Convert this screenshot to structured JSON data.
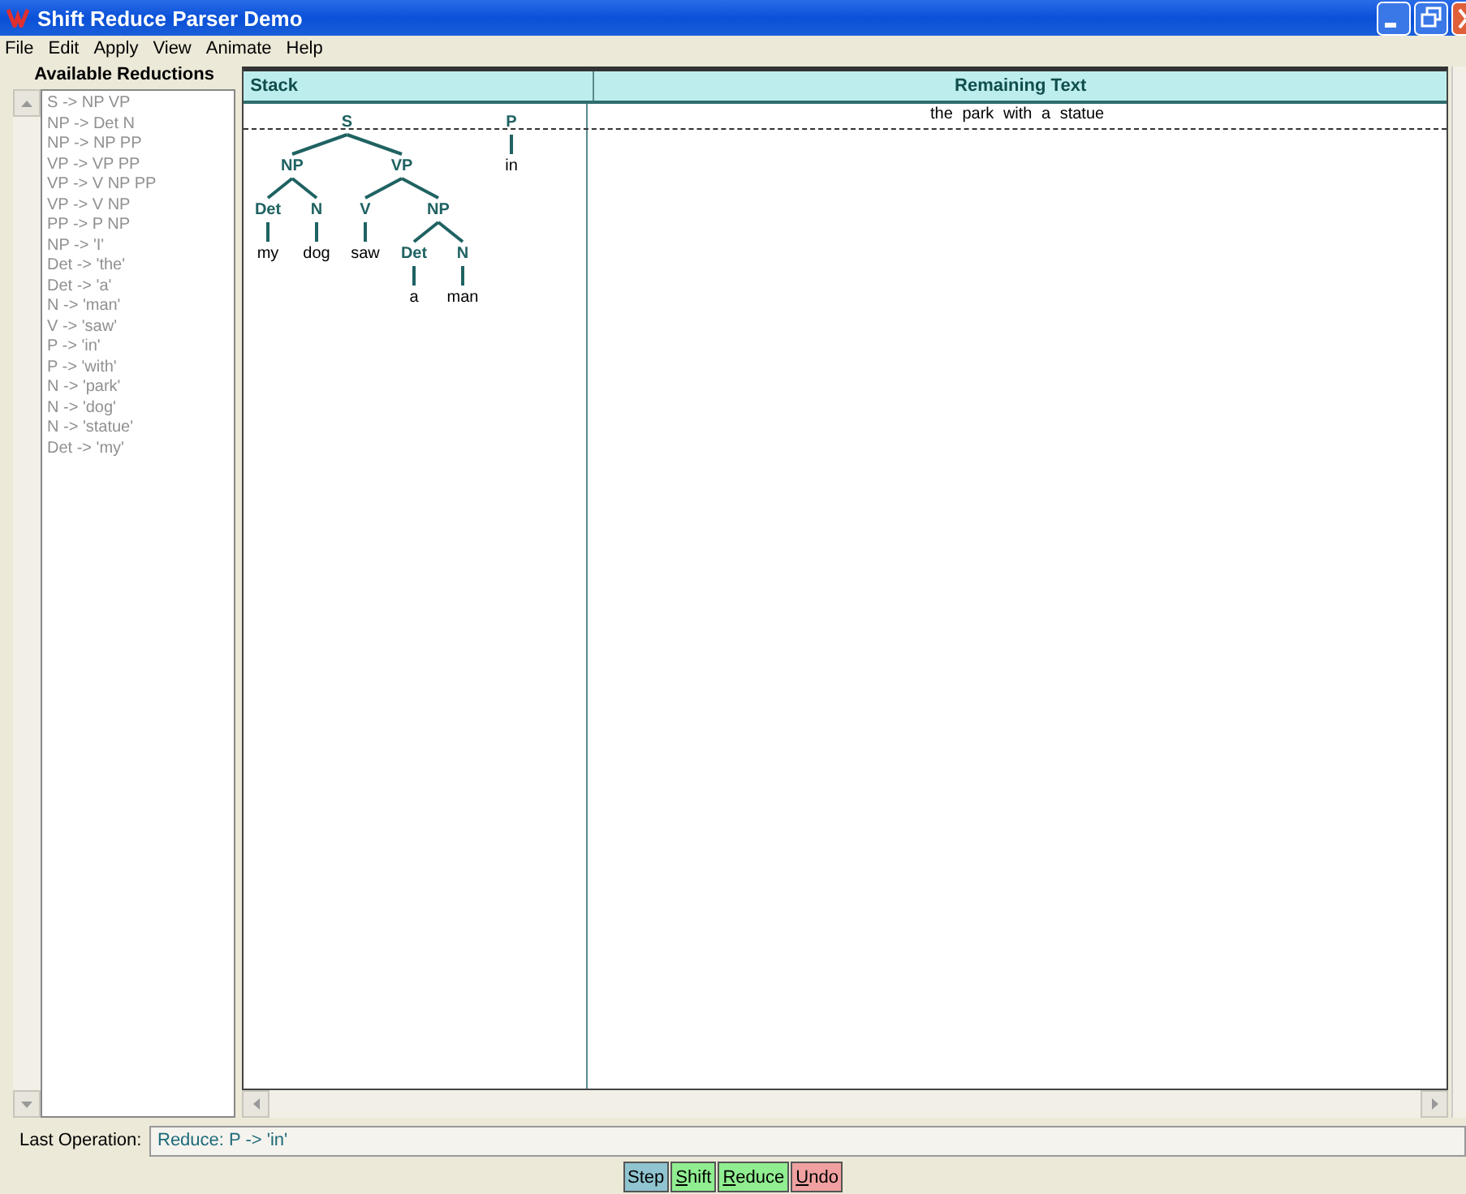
{
  "window": {
    "title": "Shift Reduce Parser Demo"
  },
  "menu": [
    "File",
    "Edit",
    "Apply",
    "View",
    "Animate",
    "Help"
  ],
  "reductions": {
    "title": "Available Reductions",
    "items": [
      {
        "label": "S -> NP VP",
        "disabled": true
      },
      {
        "label": "NP -> Det N",
        "disabled": true
      },
      {
        "label": "NP -> NP PP",
        "disabled": true
      },
      {
        "label": "VP -> VP PP",
        "disabled": true
      },
      {
        "label": "VP -> V NP PP",
        "disabled": true
      },
      {
        "label": "VP -> V NP",
        "disabled": true
      },
      {
        "label": "PP -> P NP",
        "disabled": true
      },
      {
        "label": "NP -> 'I'",
        "disabled": true
      },
      {
        "label": "Det -> 'the'",
        "disabled": true
      },
      {
        "label": "Det -> 'a'",
        "disabled": true
      },
      {
        "label": "N -> 'man'",
        "disabled": true
      },
      {
        "label": "V -> 'saw'",
        "disabled": true
      },
      {
        "label": "P -> 'in'",
        "disabled": true
      },
      {
        "label": "P -> 'with'",
        "disabled": true
      },
      {
        "label": "N -> 'park'",
        "disabled": true
      },
      {
        "label": "N -> 'dog'",
        "disabled": true
      },
      {
        "label": "N -> 'statue'",
        "disabled": true
      },
      {
        "label": "Det -> 'my'",
        "disabled": true
      }
    ]
  },
  "stack": {
    "title": "Stack",
    "trees": [
      {
        "label": "S",
        "children": [
          {
            "label": "NP",
            "children": [
              {
                "label": "Det",
                "children": [
                  {
                    "label": "my"
                  }
                ]
              },
              {
                "label": "N",
                "children": [
                  {
                    "label": "dog"
                  }
                ]
              }
            ]
          },
          {
            "label": "VP",
            "children": [
              {
                "label": "V",
                "children": [
                  {
                    "label": "saw"
                  }
                ]
              },
              {
                "label": "NP",
                "children": [
                  {
                    "label": "Det",
                    "children": [
                      {
                        "label": "a"
                      }
                    ]
                  },
                  {
                    "label": "N",
                    "children": [
                      {
                        "label": "man"
                      }
                    ]
                  }
                ]
              }
            ]
          }
        ]
      },
      {
        "label": "P",
        "children": [
          {
            "label": "in"
          }
        ]
      }
    ]
  },
  "remaining": {
    "title": "Remaining Text",
    "text": "the park with a statue"
  },
  "last_operation": {
    "label": "Last Operation:",
    "value": "Reduce:  P -> 'in'"
  },
  "buttons": [
    {
      "label": "Step",
      "color": "#8fc4d0",
      "mnemonic": false
    },
    {
      "label": "Shift",
      "color": "#90ee90",
      "mnemonic": true
    },
    {
      "label": "Reduce",
      "color": "#90ee90",
      "mnemonic": true
    },
    {
      "label": "Undo",
      "color": "#f0a0a0",
      "mnemonic": true
    }
  ]
}
